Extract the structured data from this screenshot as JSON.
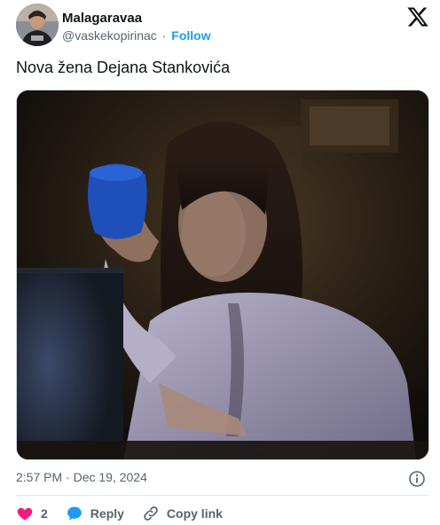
{
  "author": {
    "display_name": "Malagaravaa",
    "handle": "@vaskekopirinac",
    "separator": "·",
    "follow_label": "Follow"
  },
  "tweet": {
    "text": "Nova žena Dejana Stankovića",
    "timestamp": "2:57 PM · Dec 19, 2024"
  },
  "actions": {
    "like_count": "2",
    "reply_label": "Reply",
    "copy_link_label": "Copy link"
  },
  "icons": {
    "brand": "x-logo-icon",
    "info": "info-icon",
    "like": "heart-icon",
    "reply": "speech-bubble-icon",
    "copy_link": "link-icon"
  },
  "colors": {
    "follow": "#1d9bf0",
    "like": "#f91880",
    "reply": "#1d9bf0",
    "secondary_text": "#536471",
    "primary_text": "#0f1419"
  }
}
